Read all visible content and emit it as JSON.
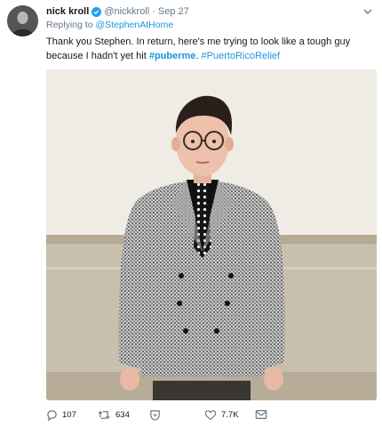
{
  "author": {
    "name": "nick kroll",
    "handle": "@nickkroll",
    "separator": "·",
    "date": "Sep 27"
  },
  "reply": {
    "prefix": "Replying to ",
    "mention": "@StephenAtHome"
  },
  "text": {
    "body": "Thank you Stephen. In return, here's me trying to look like a tough guy because I hadn't yet hit ",
    "hashtag1": "#puberme",
    "between": ". ",
    "hashtag2": "#PuertoRicoRelief"
  },
  "actions": {
    "replies": "107",
    "retweets": "634",
    "likes": "7.7K"
  },
  "colors": {
    "link": "#1b95e0",
    "verified": "#1da1f2",
    "muted": "#657786",
    "text": "#14171a"
  },
  "icons": {
    "verified": "verified-badge-icon",
    "menu": "chevron-down-icon",
    "reply": "reply-icon",
    "retweet": "retweet-icon",
    "moments": "moments-heart-shield-icon",
    "like": "heart-icon",
    "dm": "envelope-icon"
  }
}
